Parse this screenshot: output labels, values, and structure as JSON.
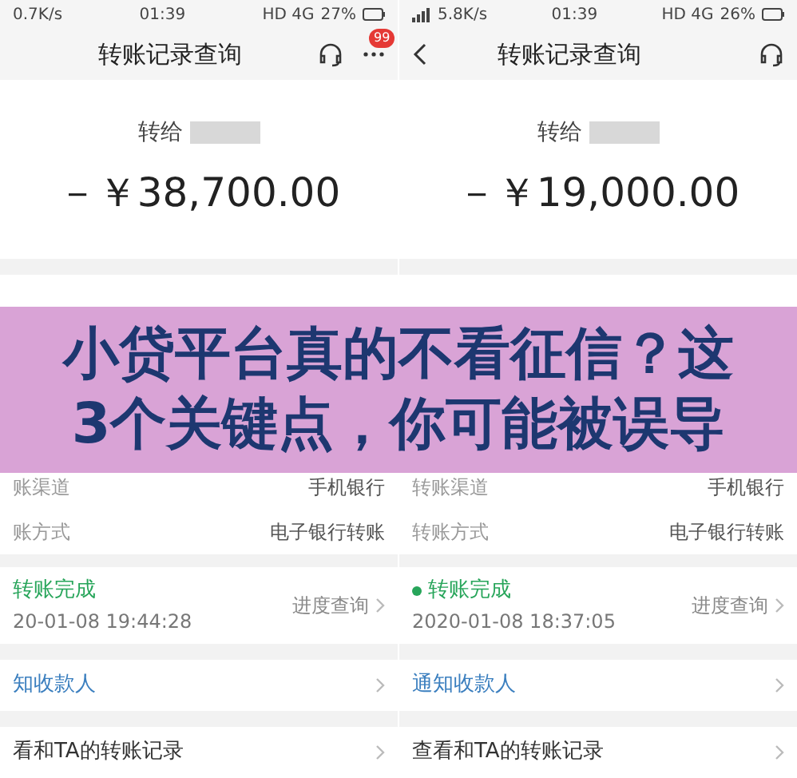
{
  "screens": [
    {
      "status_bar": {
        "speed": "0.7K/s",
        "time": "01:39",
        "network": "HD 4G",
        "battery": "27%",
        "signal": false
      },
      "header": {
        "title": "转账记录查询",
        "back": false,
        "more": true,
        "badge": "99"
      },
      "recipient_label": "转给",
      "amount": "－￥38,700.00",
      "detail_rows": [
        {
          "label": "账渠道",
          "value": "手机银行"
        },
        {
          "label": "账方式",
          "value": "电子银行转账"
        }
      ],
      "status": {
        "text": "转账完成",
        "dot": false,
        "time": "20-01-08 19:44:28",
        "action": "进度查询"
      },
      "links": [
        {
          "text": "知收款人",
          "kind": "link"
        },
        {
          "text": "看和TA的转账记录",
          "kind": "plain"
        }
      ]
    },
    {
      "status_bar": {
        "speed": "5.8K/s",
        "time": "01:39",
        "network": "HD 4G",
        "battery": "26%",
        "signal": true
      },
      "header": {
        "title": "转账记录查询",
        "back": true,
        "more": false
      },
      "recipient_label": "转给",
      "amount": "－￥19,000.00",
      "detail_rows": [
        {
          "label": "转账渠道",
          "value": "手机银行"
        },
        {
          "label": "转账方式",
          "value": "电子银行转账"
        }
      ],
      "status": {
        "text": "转账完成",
        "dot": true,
        "time": "2020-01-08 18:37:05",
        "action": "进度查询"
      },
      "links": [
        {
          "text": "通知收款人",
          "kind": "link"
        },
        {
          "text": "查看和TA的转账记录",
          "kind": "plain"
        }
      ]
    }
  ],
  "banner": {
    "lines": [
      "小贷平台真的不看征信？这",
      "3个关键点，你可能被误导"
    ]
  }
}
